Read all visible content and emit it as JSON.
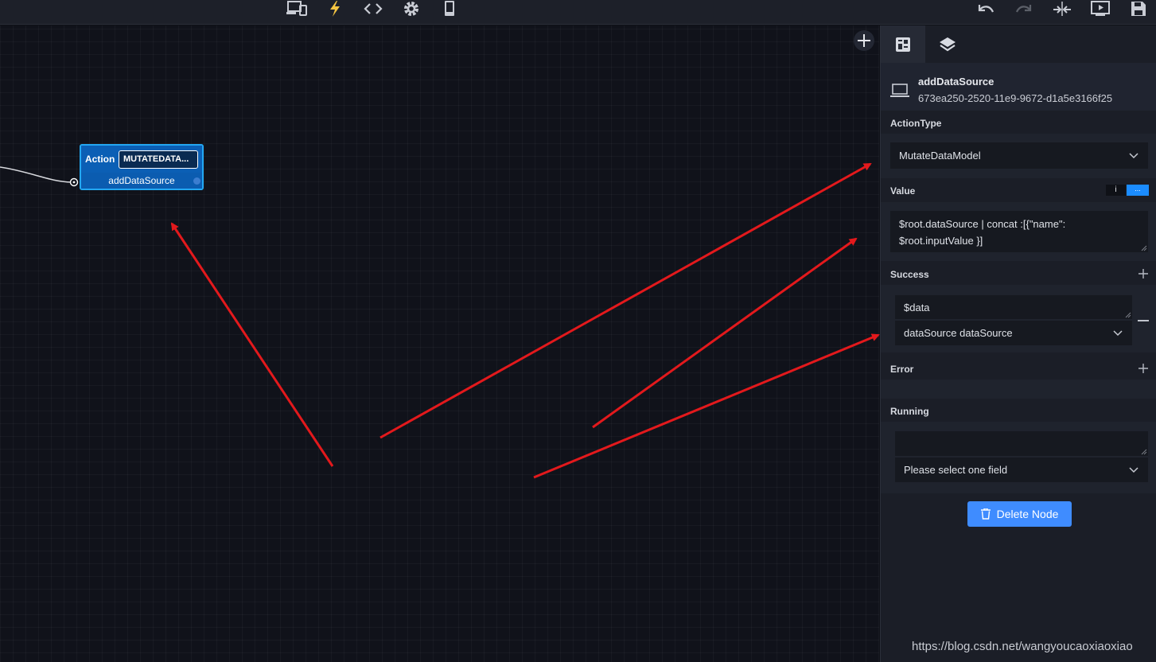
{
  "toolbar": {
    "icons": [
      "devices-icon",
      "lightning-icon",
      "code-icon",
      "gear-icon",
      "phone-icon",
      "undo-icon",
      "redo-icon",
      "merge-icon",
      "preview-icon",
      "save-icon"
    ]
  },
  "node": {
    "type_label": "Action",
    "badge": "MUTATEDATA...",
    "title": "addDataSource"
  },
  "panel": {
    "node_name": "addDataSource",
    "node_id": "673ea250-2520-11e9-9672-d1a5e3166f25",
    "action_type": {
      "label": "ActionType",
      "value": "MutateDataModel"
    },
    "value": {
      "label": "Value",
      "line1": "$root.dataSource | concat :[{\"name\":",
      "line2": "$root.inputValue }]",
      "toggle_left": "i",
      "toggle_right": "..."
    },
    "success": {
      "label": "Success",
      "input": "$data",
      "select": "dataSource dataSource"
    },
    "error": {
      "label": "Error"
    },
    "running": {
      "label": "Running",
      "input": "",
      "select_placeholder": "Please select one field"
    },
    "delete_label": "Delete Node"
  },
  "colors": {
    "accent": "#3f8cff",
    "node_border": "#23a7f2",
    "arrow": "#e3191c"
  },
  "watermark": "https://blog.csdn.net/wangyoucaoxiaoxiao"
}
